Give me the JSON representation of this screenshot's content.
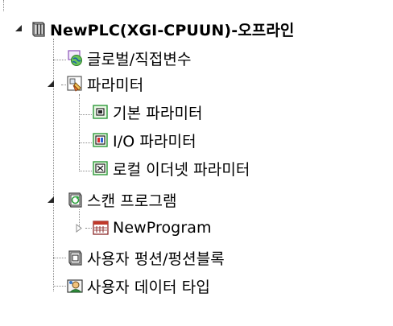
{
  "tree": {
    "root": {
      "label": "NewPLC(XGI-CPUUN)-오프라인",
      "icon": "plc-icon",
      "expanded": true
    },
    "global_vars": {
      "label": "글로벌/직접변수",
      "icon": "global-variables-icon"
    },
    "parameters": {
      "label": "파라미터",
      "icon": "parameter-icon",
      "expanded": true
    },
    "basic_param": {
      "label": "기본 파라미터",
      "icon": "basic-parameter-icon"
    },
    "io_param": {
      "label": "I/O 파라미터",
      "icon": "io-parameter-icon"
    },
    "ethernet_param": {
      "label": "로컬 이더넷 파라미터",
      "icon": "ethernet-parameter-icon"
    },
    "scan_program": {
      "label": "스캔 프로그램",
      "icon": "scan-program-icon",
      "expanded": true
    },
    "new_program": {
      "label": "NewProgram",
      "icon": "program-icon",
      "expanded": false
    },
    "user_functions": {
      "label": "사용자 펑션/펑션블록",
      "icon": "function-block-icon"
    },
    "user_datatype": {
      "label": "사용자 데이터 타입",
      "icon": "user-datatype-icon"
    }
  }
}
